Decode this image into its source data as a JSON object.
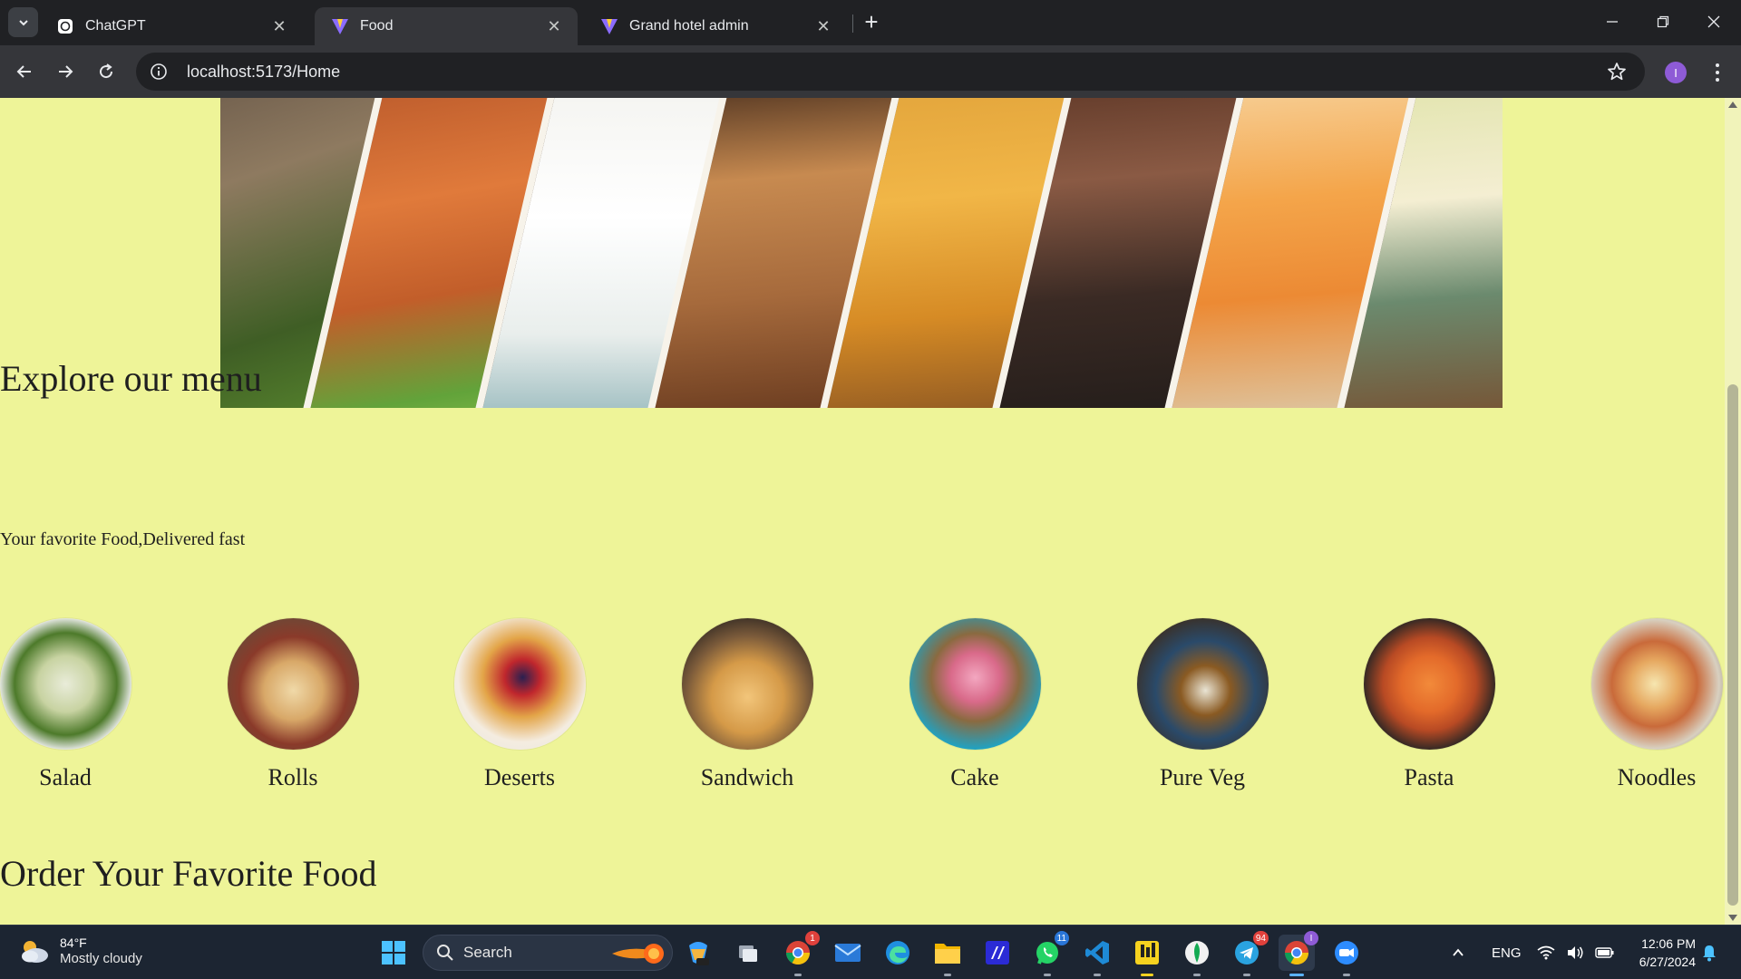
{
  "browser": {
    "tabs": [
      {
        "title": "ChatGPT",
        "icon": "chatgpt-icon",
        "active": false
      },
      {
        "title": "Food",
        "icon": "vite-icon",
        "active": true
      },
      {
        "title": "Grand hotel admin",
        "icon": "vite-icon",
        "active": false
      }
    ],
    "url": "localhost:5173/Home",
    "profile_initial": "I"
  },
  "page": {
    "background": "#eef498",
    "explore_heading": "Explore our menu",
    "explore_sub": "Your favorite Food,Delivered fast",
    "menu": [
      {
        "label": "Salad",
        "icon": "salad-image"
      },
      {
        "label": "Rolls",
        "icon": "rolls-image"
      },
      {
        "label": "Deserts",
        "icon": "deserts-image"
      },
      {
        "label": "Sandwich",
        "icon": "sandwich-image"
      },
      {
        "label": "Cake",
        "icon": "cake-image"
      },
      {
        "label": "Pure Veg",
        "icon": "pure-veg-image"
      },
      {
        "label": "Pasta",
        "icon": "pasta-image"
      },
      {
        "label": "Noodles",
        "icon": "noodles-image"
      }
    ],
    "order_heading": "Order Your Favorite Food"
  },
  "taskbar": {
    "weather_temp": "84°F",
    "weather_cond": "Mostly cloudy",
    "search_placeholder": "Search",
    "language": "ENG",
    "time": "12:06 PM",
    "date": "6/27/2024",
    "chrome_badge": "1",
    "whatsapp_badge": "11",
    "telegram_badge": "94",
    "profile_badge": "I"
  }
}
